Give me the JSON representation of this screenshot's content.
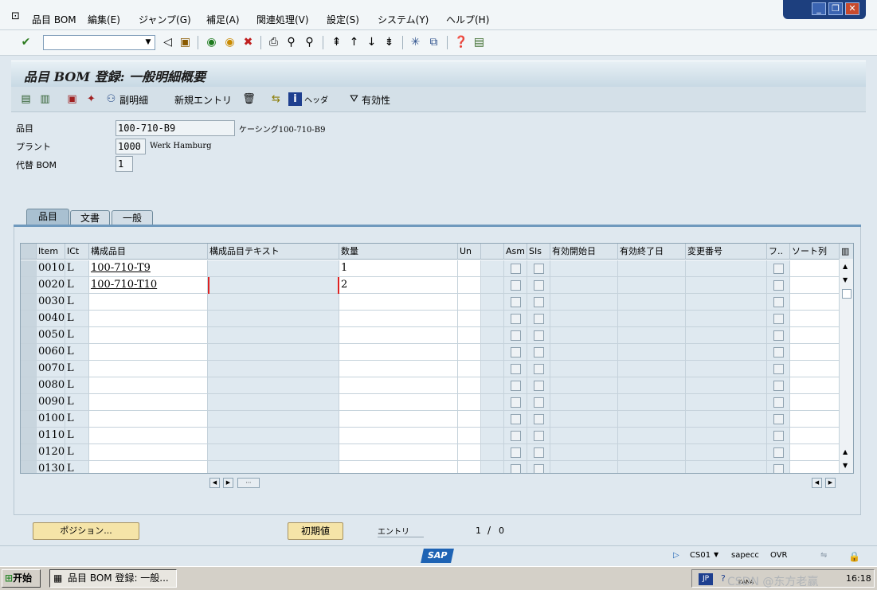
{
  "menu": [
    "品目 BOM",
    "編集(E)",
    "ジャンプ(G)",
    "補足(A)",
    "関連処理(V)",
    "設定(S)",
    "システム(Y)",
    "ヘルプ(H)"
  ],
  "page_title": "品目 BOM 登録: 一般明細概要",
  "app_toolbar": {
    "sub_item": "副明細",
    "new_entries": "新規エントリ",
    "header": "ヘッダ",
    "validity": "有効性"
  },
  "header": {
    "material_label": "品目",
    "material_value": "100-710-B9",
    "material_desc": "ケーシング100-710-B9",
    "plant_label": "プラント",
    "plant_value": "1000",
    "plant_desc": "Werk Hamburg",
    "alt_bom_label": "代替 BOM",
    "alt_bom_value": "1"
  },
  "tabs": [
    "品目",
    "文書",
    "一般"
  ],
  "columns": [
    "Item",
    "ICt",
    "構成品目",
    "構成品目テキスト",
    "数量",
    "Un",
    "",
    "Asm",
    "SIs",
    "有効開始日",
    "有効終了日",
    "変更番号",
    "フ..",
    "ソート列"
  ],
  "rows": [
    {
      "item": "0010",
      "ict": "L",
      "component": "100-710-T9",
      "text": "",
      "qty": "1"
    },
    {
      "item": "0020",
      "ict": "L",
      "component": "100-710-T10",
      "text": "",
      "qty": "2"
    },
    {
      "item": "0030",
      "ict": "L",
      "component": "",
      "text": "",
      "qty": ""
    },
    {
      "item": "0040",
      "ict": "L",
      "component": "",
      "text": "",
      "qty": ""
    },
    {
      "item": "0050",
      "ict": "L",
      "component": "",
      "text": "",
      "qty": ""
    },
    {
      "item": "0060",
      "ict": "L",
      "component": "",
      "text": "",
      "qty": ""
    },
    {
      "item": "0070",
      "ict": "L",
      "component": "",
      "text": "",
      "qty": ""
    },
    {
      "item": "0080",
      "ict": "L",
      "component": "",
      "text": "",
      "qty": ""
    },
    {
      "item": "0090",
      "ict": "L",
      "component": "",
      "text": "",
      "qty": ""
    },
    {
      "item": "0100",
      "ict": "L",
      "component": "",
      "text": "",
      "qty": ""
    },
    {
      "item": "0110",
      "ict": "L",
      "component": "",
      "text": "",
      "qty": ""
    },
    {
      "item": "0120",
      "ict": "L",
      "component": "",
      "text": "",
      "qty": ""
    },
    {
      "item": "0130",
      "ict": "L",
      "component": "",
      "text": "",
      "qty": ""
    }
  ],
  "bottom": {
    "position_button": "ポジション...",
    "initial_button": "初期値",
    "entry_label": "エントリ",
    "entry_count": "1",
    "entry_sep": "/",
    "entry_total": "0"
  },
  "status": {
    "transaction": "CS01",
    "system": "sapecc",
    "mode": "OVR",
    "sap_logo": "SAP"
  },
  "taskbar": {
    "start": "开始",
    "task": "品目 BOM 登録: 一般...",
    "lang": "JP",
    "ime": "KANA",
    "watermark": "CSDN @东方老赢",
    "time": "16:18"
  }
}
